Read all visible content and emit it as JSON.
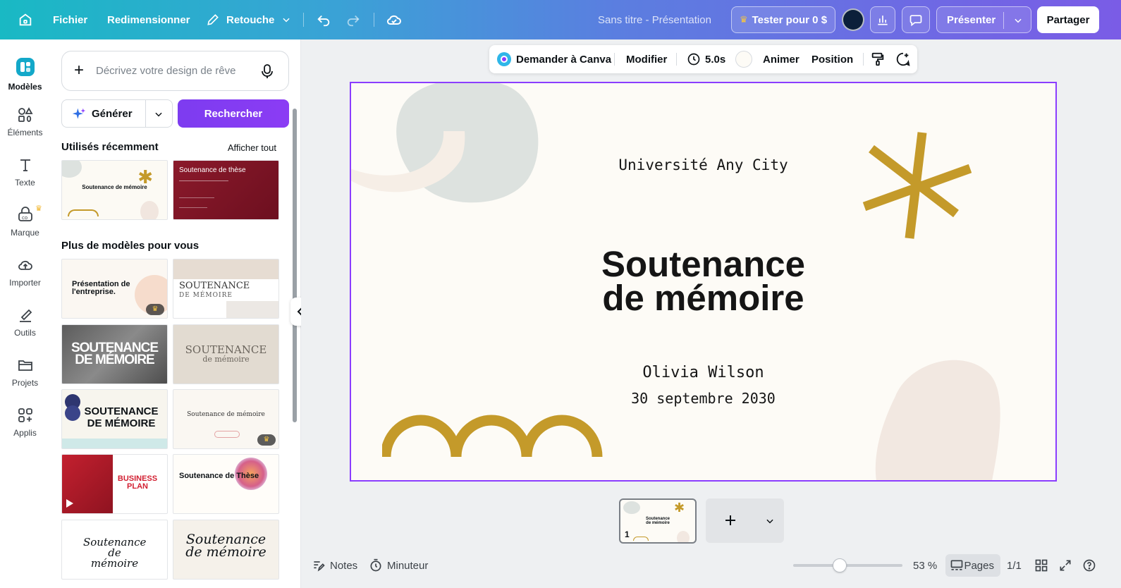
{
  "topbar": {
    "fichier": "Fichier",
    "redimensionner": "Redimensionner",
    "retouche": "Retouche",
    "doc_title": "Sans titre - Présentation",
    "try_label": "Tester pour 0 $",
    "present_label": "Présenter",
    "share_label": "Partager"
  },
  "rail": {
    "items": [
      "Modèles",
      "Éléments",
      "Texte",
      "Marque",
      "Importer",
      "Outils",
      "Projets",
      "Applis"
    ]
  },
  "panel": {
    "prompt_placeholder": "Décrivez votre design de rêve",
    "generate_label": "Générer",
    "search_label": "Rechercher",
    "recent_title": "Utilisés récemment",
    "see_all": "Afficher tout",
    "more_title": "Plus de modèles pour vous",
    "thumbs": {
      "recent1_title": "Soutenance de mémoire",
      "recent2_title": "Soutenance de thèse",
      "t1": "Présentation de l'entreprise.",
      "t2": "SOUTENANCE",
      "t2b": "DE MÉMOIRE",
      "t3": "SOUTENANCE DE MÉMOIRE",
      "t4": "SOUTENANCE",
      "t4b": "de mémoire",
      "t5": "SOUTENANCE DE MÉMOIRE",
      "t6": "Soutenance de mémoire",
      "t7": "BUSINESS PLAN",
      "t8": "Soutenance de Thèse",
      "t9": "Soutenance de mémoire",
      "t10": "Soutenance de mémoire"
    }
  },
  "context_toolbar": {
    "ask_canva": "Demander à Canva",
    "edit": "Modifier",
    "duration": "5.0s",
    "animate": "Animer",
    "position": "Position"
  },
  "slide": {
    "university": "Université Any City",
    "title_line1": "Soutenance",
    "title_line2": "de mémoire",
    "author": "Olivia Wilson",
    "date": "30 septembre 2030",
    "accent_color": "#c49a2a",
    "background_color": "#fdfbf6"
  },
  "pages": {
    "current_number": "1"
  },
  "bottom": {
    "notes": "Notes",
    "timer": "Minuteur",
    "zoom": "53 %",
    "zoom_level": 0.53,
    "pages_label": "Pages",
    "page_count": "1/1"
  },
  "colors": {
    "brand_purple": "#8b3dff",
    "topbar_start": "#19b9c4",
    "topbar_end": "#7a5ce6"
  }
}
